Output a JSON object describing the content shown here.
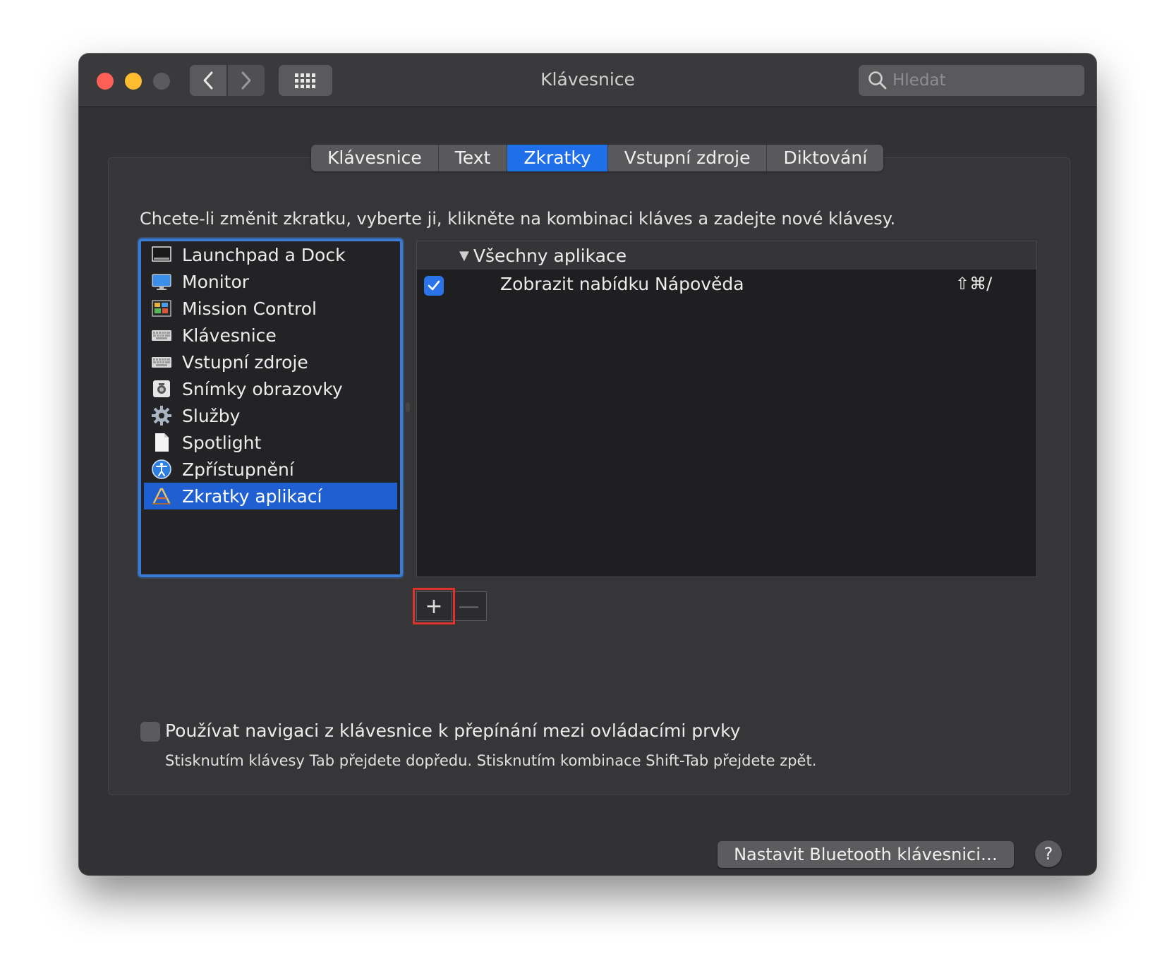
{
  "window": {
    "title": "Klávesnice",
    "search_placeholder": "Hledat"
  },
  "tabs": [
    {
      "label": "Klávesnice",
      "active": false
    },
    {
      "label": "Text",
      "active": false
    },
    {
      "label": "Zkratky",
      "active": true
    },
    {
      "label": "Vstupní zdroje",
      "active": false
    },
    {
      "label": "Diktování",
      "active": false
    }
  ],
  "instruction": "Chcete-li změnit zkratku, vyberte ji, klikněte na kombinaci kláves a zadejte nové klávesy.",
  "categories": [
    {
      "label": "Launchpad a Dock",
      "icon": "launchpad-icon"
    },
    {
      "label": "Monitor",
      "icon": "monitor-icon"
    },
    {
      "label": "Mission Control",
      "icon": "mission-control-icon"
    },
    {
      "label": "Klávesnice",
      "icon": "keyboard-icon"
    },
    {
      "label": "Vstupní zdroje",
      "icon": "keyboard-icon"
    },
    {
      "label": "Snímky obrazovky",
      "icon": "screenshot-icon"
    },
    {
      "label": "Služby",
      "icon": "gear-icon"
    },
    {
      "label": "Spotlight",
      "icon": "document-icon"
    },
    {
      "label": "Zpřístupnění",
      "icon": "accessibility-icon"
    },
    {
      "label": "Zkratky aplikací",
      "icon": "app-store-icon",
      "selected": true
    }
  ],
  "shortcuts_panel": {
    "group_label": "Všechny aplikace",
    "rows": [
      {
        "label": "Zobrazit nabídku Nápověda",
        "keys": "⇧⌘/",
        "enabled": true
      }
    ]
  },
  "buttons": {
    "add": "+",
    "remove": "—",
    "bluetooth": "Nastavit Bluetooth klávesnici…",
    "help": "?"
  },
  "keyboard_navigation": {
    "label": "Používat navigaci z klávesnice k přepínání mezi ovládacími prvky",
    "hint": "Stisknutím klávesy Tab přejdete dopředu. Stisknutím kombinace Shift-Tab přejdete zpět.",
    "checked": false
  },
  "colors": {
    "accent": "#1f6fe8",
    "highlight_box": "#e0322b"
  }
}
